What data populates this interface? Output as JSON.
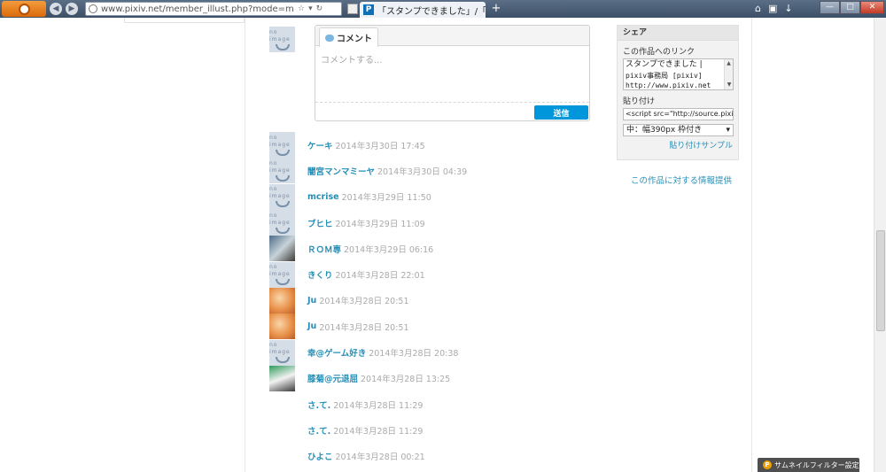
{
  "browser": {
    "url": "www.pixiv.net/member_illust.php?mode=medi",
    "tab_title": "「スタンプできました」/「pi...",
    "tab_favicon": "P"
  },
  "comment_form": {
    "tab_label": "コメント",
    "placeholder": "コメントする...",
    "send_label": "送信",
    "avatar_text": "no image"
  },
  "comments": [
    {
      "name": "ケーキ",
      "date": "2014年3月30日 17:45",
      "avatar": "default"
    },
    {
      "name": "闇宮マンマミーヤ",
      "date": "2014年3月30日 04:39",
      "avatar": "default"
    },
    {
      "name": "mcrise",
      "date": "2014年3月29日 11:50",
      "avatar": "default"
    },
    {
      "name": "ブヒヒ",
      "date": "2014年3月29日 11:09",
      "avatar": "default"
    },
    {
      "name": "ＲＯＭ専",
      "date": "2014年3月29日 06:16",
      "avatar": "image"
    },
    {
      "name": "きくり",
      "date": "2014年3月28日 22:01",
      "avatar": "default"
    },
    {
      "name": "Ju",
      "date": "2014年3月28日 20:51",
      "avatar": "image"
    },
    {
      "name": "Ju",
      "date": "2014年3月28日 20:51",
      "avatar": "image"
    },
    {
      "name": "幸@ゲーム好き",
      "date": "2014年3月28日 20:38",
      "avatar": "default"
    },
    {
      "name": "膝菊@元退屈",
      "date": "2014年3月28日 13:25",
      "avatar": "image"
    },
    {
      "name": "さ.て.",
      "date": "2014年3月28日 11:29",
      "avatar": "none"
    },
    {
      "name": "さ.て.",
      "date": "2014年3月28日 11:29",
      "avatar": "none"
    },
    {
      "name": "ひよこ",
      "date": "2014年3月28日 00:21",
      "avatar": "none"
    }
  ],
  "share": {
    "heading": "シェア",
    "link_label": "この作品へのリンク",
    "link_lines": [
      "スタンプできました |",
      "pixiv事務局 [pixiv]",
      "http://www.pixiv.net"
    ],
    "paste_label": "貼り付け",
    "paste_code": "<script src=\"http://source.pixiv.n",
    "size_option": "中：幅390px 枠付き",
    "sample_link": "貼り付けサンプル"
  },
  "info_link": "この作品に対する情報提供",
  "thumbnail_filter": {
    "label": "サムネイルフィルター設定",
    "icon": "P"
  },
  "colors": {
    "accent": "#0096db",
    "link": "#258fb8",
    "date": "#aaaaaa"
  }
}
